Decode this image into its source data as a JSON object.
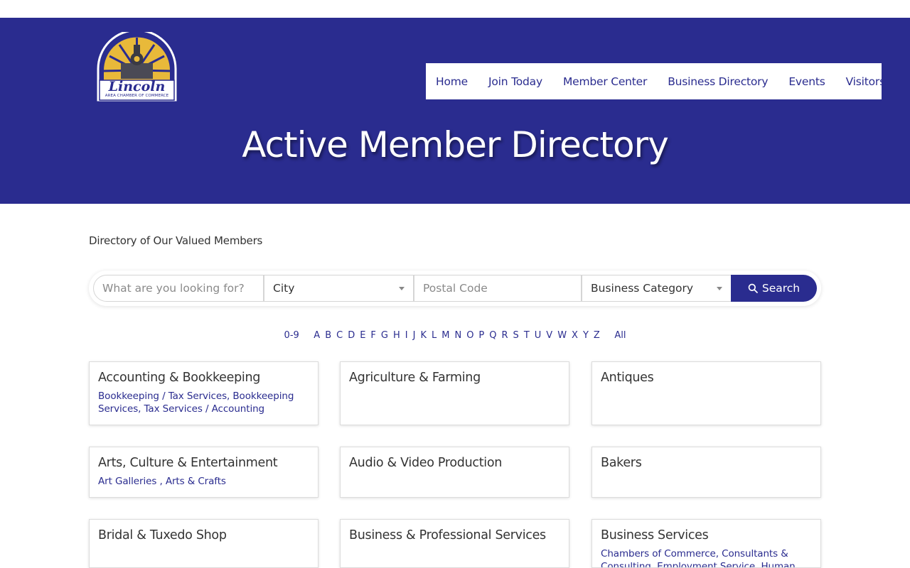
{
  "logo": {
    "title": "Lincoln",
    "subtitle": "AREA CHAMBER OF COMMERCE"
  },
  "nav": {
    "items": [
      {
        "label": "Home"
      },
      {
        "label": "Join Today"
      },
      {
        "label": "Member Center"
      },
      {
        "label": "Business Directory"
      },
      {
        "label": "Events"
      },
      {
        "label": "Visitors"
      }
    ]
  },
  "page": {
    "title": "Active Member Directory",
    "subtitle": "Directory of Our Valued Members"
  },
  "search": {
    "keyword_placeholder": "What are you looking for?",
    "city_value": "City",
    "postal_placeholder": "Postal Code",
    "category_value": "Business Category",
    "button_label": "Search"
  },
  "alphabet": {
    "first": "0-9",
    "letters": [
      "A",
      "B",
      "C",
      "D",
      "E",
      "F",
      "G",
      "H",
      "I",
      "J",
      "K",
      "L",
      "M",
      "N",
      "O",
      "P",
      "Q",
      "R",
      "S",
      "T",
      "U",
      "V",
      "W",
      "X",
      "Y",
      "Z"
    ],
    "last": "All"
  },
  "categories": [
    {
      "title": "Accounting & Bookkeeping",
      "links": "Bookkeeping / Tax Services, Bookkeeping Services, Tax Services / Accounting"
    },
    {
      "title": "Agriculture & Farming",
      "links": ""
    },
    {
      "title": "Antiques",
      "links": ""
    },
    {
      "title": "Arts, Culture & Entertainment",
      "links": "Art Galleries , Arts & Crafts"
    },
    {
      "title": "Audio & Video Production",
      "links": ""
    },
    {
      "title": "Bakers",
      "links": ""
    },
    {
      "title": "Bridal & Tuxedo Shop",
      "links": ""
    },
    {
      "title": "Business & Professional Services",
      "links": ""
    },
    {
      "title": "Business Services",
      "links": "Chambers of Commerce, Consultants & Consulting, Employment Service, Human"
    }
  ],
  "colors": {
    "brand": "#2a2c8f",
    "logo_gold": "#e8b93a"
  }
}
